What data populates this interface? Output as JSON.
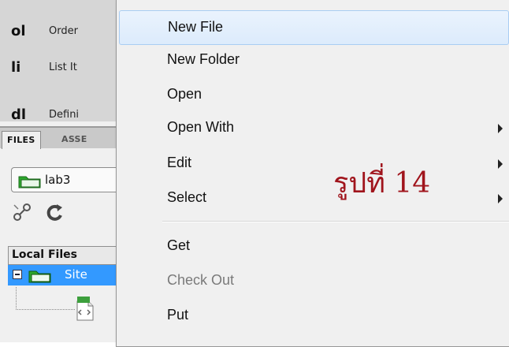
{
  "insert_panel": {
    "items": [
      {
        "tag": "ol",
        "label": "Order"
      },
      {
        "tag": "li",
        "label": "List It"
      },
      {
        "tag": "dl",
        "label": "Defini"
      }
    ]
  },
  "files_panel": {
    "tabs": [
      {
        "label": "FILES",
        "active": true
      },
      {
        "label": "ASSE",
        "active": false
      }
    ],
    "site_name": "lab3",
    "toolbar_icons": [
      "connect-icon",
      "refresh-icon"
    ],
    "column_header": "Local Files",
    "tree": {
      "site_label": "Site",
      "selected_color": "#3399ff"
    }
  },
  "context_menu": {
    "items": [
      {
        "label": "New File",
        "highlighted": true
      },
      {
        "label": "New Folder"
      },
      {
        "label": "Open"
      },
      {
        "label": "Open With",
        "submenu": true
      },
      {
        "label": "Edit",
        "submenu": true
      },
      {
        "label": "Select",
        "submenu": true
      },
      {
        "label": "Get"
      },
      {
        "label": "Check Out",
        "disabled": true
      },
      {
        "label": "Put"
      }
    ]
  },
  "annotation": {
    "text": "รูปที่ 14",
    "color": "#a0141c"
  }
}
